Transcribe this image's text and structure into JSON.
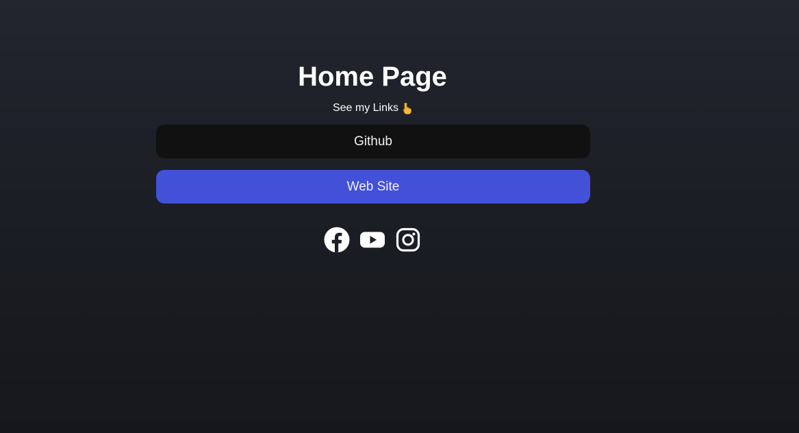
{
  "page": {
    "title": "Home Page",
    "subtitle": "See my Links"
  },
  "links": [
    {
      "label": "Github",
      "color": "#111111"
    },
    {
      "label": "Web Site",
      "color": "#4350d8"
    }
  ],
  "socials": [
    {
      "icon": "facebook-icon"
    },
    {
      "icon": "youtube-icon"
    },
    {
      "icon": "instagram-icon"
    }
  ],
  "emoji": {
    "icon": "pointing-down-hand-icon",
    "color": "#f5b93a"
  },
  "colors": {
    "background_top": "#23252f",
    "background_bottom": "#16171b",
    "text": "#ffffff"
  }
}
